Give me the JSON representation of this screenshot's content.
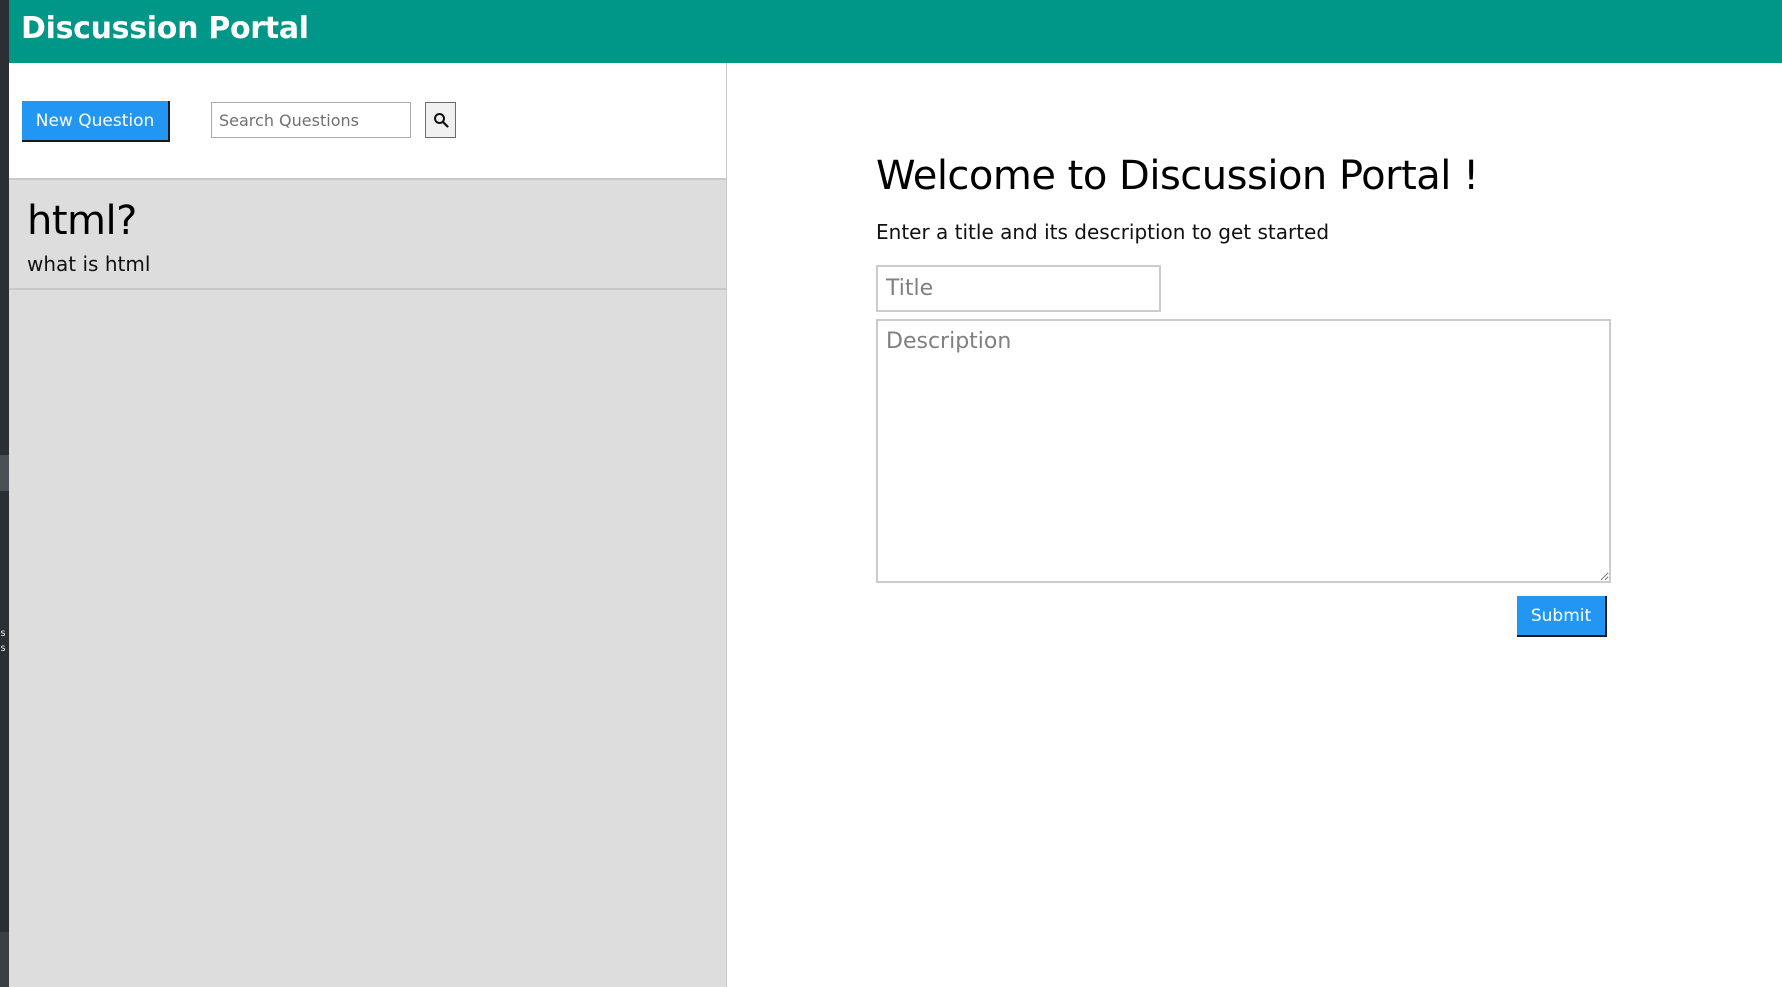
{
  "app": {
    "title": "Discussion Portal",
    "accent_color": "#009688",
    "button_color": "#2196f3"
  },
  "edge": {
    "letters": "s s"
  },
  "sidebar": {
    "new_question_label": "New Question",
    "search": {
      "placeholder": "Search Questions",
      "value": "",
      "icon": "search-icon"
    },
    "questions": [
      {
        "title": "html?",
        "description": "what is html"
      }
    ]
  },
  "main": {
    "heading": "Welcome to Discussion Portal !",
    "subtext": "Enter a title and its description to get started",
    "title_field": {
      "placeholder": "Title",
      "value": ""
    },
    "description_field": {
      "placeholder": "Description",
      "value": ""
    },
    "submit_label": "Submit"
  }
}
